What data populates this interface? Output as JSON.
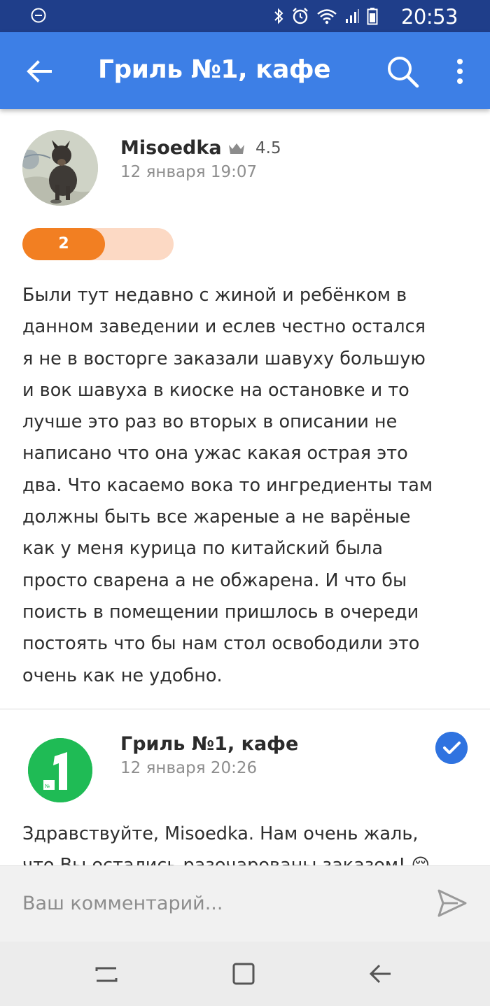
{
  "status_bar": {
    "time": "20:53",
    "icons": [
      "do-not-disturb-icon",
      "bluetooth-icon",
      "alarm-icon",
      "wifi-icon",
      "signal-icon",
      "battery-icon"
    ]
  },
  "app_bar": {
    "title": "Гриль №1, кафе",
    "back_icon": "arrow-left-icon",
    "search_icon": "search-icon",
    "more_icon": "more-vertical-icon",
    "color": "#3d7fe6"
  },
  "review": {
    "author": "Misoedka",
    "author_rating": "4.5",
    "date": "12 января 19:07",
    "score": "2",
    "score_fraction": 0.4,
    "score_colors": {
      "fill": "#f27f22",
      "track": "#fcd9c4"
    },
    "text_lines": [
      "Были тут недавно с жиной и ребёнком в",
      "данном заведении и еслев честно остался",
      "я не в восторге заказали шавуху большую",
      "и вок шавуха в киоске на остановке и то",
      "лучше это раз во вторых в описании не",
      "написано что она ужас какая острая это",
      "два. Что касаемо вока то ингредиенты там",
      "должны быть все жареные а не варёные",
      "как у меня курица по китайский была",
      "просто сварена а не обжарена. И что бы",
      "поисть в помещении пришлось в очереди",
      "постоять что бы нам стол освободили это",
      "очень как не удобно."
    ]
  },
  "reply": {
    "author": "Гриль №1, кафе",
    "date": "12 января 20:26",
    "verified_icon": "verified-check-icon",
    "logo_color": "#1fbb55",
    "text_lines": [
      "Здравствуйте, Misoedka. Нам очень жаль,",
      "что Вы остались разочарованы заказом! 😔"
    ]
  },
  "comment": {
    "placeholder": "Ваш комментарий...",
    "send_icon": "send-icon"
  },
  "nav_bar": {
    "icons": [
      "recent-apps-icon",
      "home-icon",
      "nav-back-icon"
    ]
  }
}
